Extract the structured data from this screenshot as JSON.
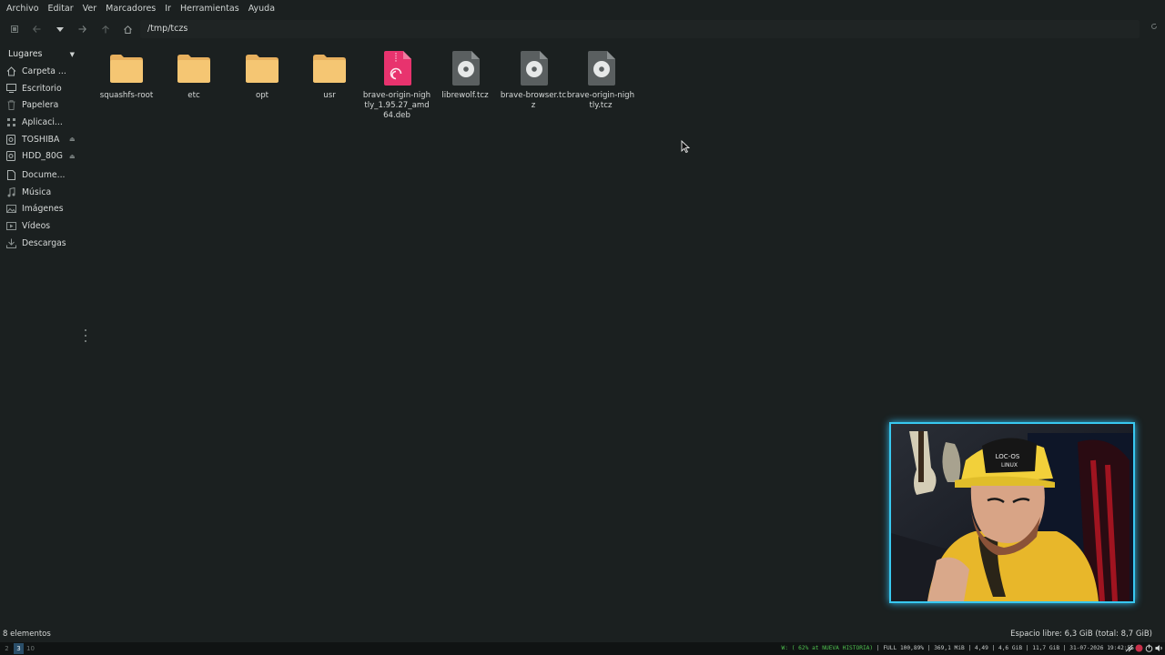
{
  "menu": [
    "Archivo",
    "Editar",
    "Ver",
    "Marcadores",
    "Ir",
    "Herramientas",
    "Ayuda"
  ],
  "toolbar": {
    "path": "/tmp/tczs"
  },
  "sidebar": {
    "header": "Lugares",
    "items": [
      {
        "label": "Carpeta ...",
        "icon": "home-icon"
      },
      {
        "label": "Escritorio",
        "icon": "desktop-icon"
      },
      {
        "label": "Papelera",
        "icon": "trash-icon"
      },
      {
        "label": "Aplicaci...",
        "icon": "apps-icon"
      },
      {
        "label": "TOSHIBA",
        "icon": "drive-icon",
        "eject": true
      },
      {
        "label": "HDD_80G",
        "icon": "drive-icon",
        "eject": true
      },
      {
        "label": "Docume...",
        "icon": "document-icon"
      },
      {
        "label": "Música",
        "icon": "music-icon"
      },
      {
        "label": "Imágenes",
        "icon": "image-icon"
      },
      {
        "label": "Vídeos",
        "icon": "video-icon"
      },
      {
        "label": "Descargas",
        "icon": "download-icon"
      }
    ]
  },
  "files": [
    {
      "name": "squashfs-root",
      "type": "folder"
    },
    {
      "name": "etc",
      "type": "folder"
    },
    {
      "name": "opt",
      "type": "folder"
    },
    {
      "name": "usr",
      "type": "folder"
    },
    {
      "name": "brave-origin-nightly_1.95.27_amd64.deb",
      "type": "deb"
    },
    {
      "name": "librewolf.tcz",
      "type": "disc"
    },
    {
      "name": "brave-browser.tcz",
      "type": "disc"
    },
    {
      "name": "brave-origin-nightly.tcz",
      "type": "disc"
    }
  ],
  "status": {
    "count": "8 elementos",
    "free_space": "Espacio libre: 6,3 GiB (total: 8,7 GiB)"
  },
  "panel": {
    "workspaces": [
      "2",
      "3",
      "10"
    ],
    "active_workspace": "3",
    "wifi": "W: ( 62% at NUEVA HISTORIA)",
    "info": "FULL 100,89% | 369,1 MiB | 4,49 | 4,6 GiB | 11,7 GiB | 31-07-2026 19:42:55"
  },
  "colors": {
    "background": "#1b2020",
    "folder": "#f4c471",
    "deb": "#e8336e",
    "webcam_border": "#38c8f0"
  }
}
